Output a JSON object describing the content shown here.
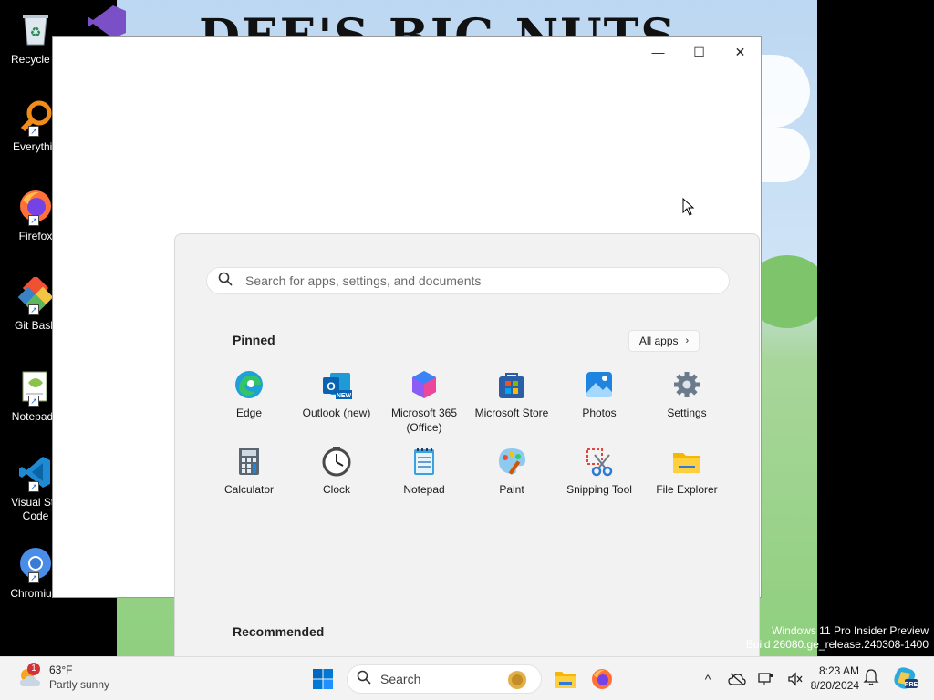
{
  "desktop": {
    "headline": "DEE'S BIG NUTS",
    "watermark": {
      "line1": "Windows 11 Pro Insider Preview",
      "line2": "Build 26080.ge_release.240308-1400"
    },
    "icons": [
      {
        "label": "Recycle B",
        "icon": "recycle-bin-icon"
      },
      {
        "label": "Everythin",
        "icon": "everything-search-icon"
      },
      {
        "label": "Firefox",
        "icon": "firefox-icon"
      },
      {
        "label": "Git Bash",
        "icon": "git-bash-icon"
      },
      {
        "label": "Notepad+",
        "icon": "notepad-plus-plus-icon"
      },
      {
        "label": "Visual Stu Code",
        "icon": "vscode-icon"
      },
      {
        "label": "Chromium",
        "icon": "chromium-icon"
      }
    ]
  },
  "window": {
    "minimize": "—",
    "maximize": "☐",
    "close": "✕"
  },
  "start_menu": {
    "search_placeholder": "Search for apps, settings, and documents",
    "pinned_title": "Pinned",
    "all_apps_label": "All apps",
    "recommended_title": "Recommended",
    "pinned": [
      {
        "label": "Edge",
        "icon": "edge-icon"
      },
      {
        "label": "Outlook (new)",
        "icon": "outlook-icon"
      },
      {
        "label": "Microsoft 365 (Office)",
        "icon": "microsoft-365-icon"
      },
      {
        "label": "Microsoft Store",
        "icon": "microsoft-store-icon"
      },
      {
        "label": "Photos",
        "icon": "photos-icon"
      },
      {
        "label": "Settings",
        "icon": "settings-gear-icon"
      },
      {
        "label": "Calculator",
        "icon": "calculator-icon"
      },
      {
        "label": "Clock",
        "icon": "clock-icon"
      },
      {
        "label": "Notepad",
        "icon": "notepad-icon"
      },
      {
        "label": "Paint",
        "icon": "paint-icon"
      },
      {
        "label": "Snipping Tool",
        "icon": "snipping-tool-icon"
      },
      {
        "label": "File Explorer",
        "icon": "file-explorer-icon"
      }
    ]
  },
  "taskbar": {
    "weather": {
      "temp": "63°F",
      "desc": "Partly sunny",
      "badge": "1"
    },
    "search_label": "Search",
    "time": "8:23 AM",
    "date": "8/20/2024",
    "colors": {
      "accent": "#0067c0",
      "badge": "#d13438"
    }
  }
}
